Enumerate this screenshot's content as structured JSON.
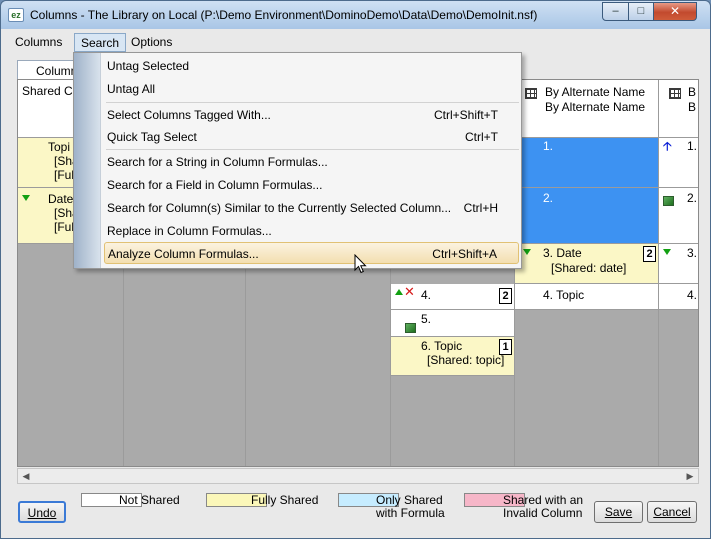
{
  "window": {
    "title": "Columns - The Library on Local (P:\\Demo Environment\\DominoDemo\\Data\\Demo\\DemoInit.nsf)",
    "icon_text": "ez",
    "minimize_glyph": "–",
    "maximize_glyph": "□",
    "close_glyph": "✕"
  },
  "menubar": [
    "Columns",
    "Search",
    "Options"
  ],
  "tab": {
    "label": "Columns"
  },
  "grid": {
    "col1_header": "Shared Co",
    "col1_row1": [
      "Topi",
      "[Sha",
      "[Ful"
    ],
    "col1_row2": [
      "Date",
      "[Sha",
      "[Ful"
    ],
    "col4_rows": [
      {
        "text": "4.",
        "badge": "2"
      },
      {
        "text": "5."
      },
      {
        "title": "6. Topic",
        "sub": "[Shared: topic]",
        "badge": "1"
      }
    ],
    "col5_header": [
      "By Alternate Name",
      "By Alternate Name"
    ],
    "col5_rows": [
      {
        "text": "1."
      },
      {
        "text": "2."
      },
      {
        "title": "3. Date",
        "sub": "[Shared: date]",
        "badge": "2"
      },
      {
        "text": "4. Topic"
      }
    ],
    "col6_header": [
      "B",
      "B"
    ],
    "col6_rows": [
      "1.",
      "2.",
      "3.",
      "4."
    ]
  },
  "legend": [
    {
      "label": "Not Shared",
      "color": "#ffffff"
    },
    {
      "label": "Fully Shared",
      "color": "#fbf7b9"
    },
    {
      "label": "Only Shared\nwith Formula",
      "color": "#c6ecff"
    },
    {
      "label": "Shared with an\nInvalid Column",
      "color": "#f6b6c8"
    }
  ],
  "buttons": {
    "undo": "Undo",
    "save": "Save",
    "cancel": "Cancel"
  },
  "search_menu": [
    {
      "label": "Untag Selected",
      "shortcut": ""
    },
    {
      "label": "Untag All",
      "shortcut": ""
    },
    {
      "label": "Select Columns Tagged With...",
      "shortcut": "Ctrl+Shift+T"
    },
    {
      "label": "Quick Tag Select",
      "shortcut": "Ctrl+T"
    },
    {
      "label": "Search for a String in Column Formulas...",
      "shortcut": ""
    },
    {
      "label": "Search for a Field in Column Formulas...",
      "shortcut": ""
    },
    {
      "label": "Search for Column(s) Similar to the Currently Selected Column...",
      "shortcut": "Ctrl+H"
    },
    {
      "label": "Replace in Column Formulas...",
      "shortcut": ""
    },
    {
      "label": "Analyze Column Formulas...",
      "shortcut": "Ctrl+Shift+A"
    }
  ]
}
